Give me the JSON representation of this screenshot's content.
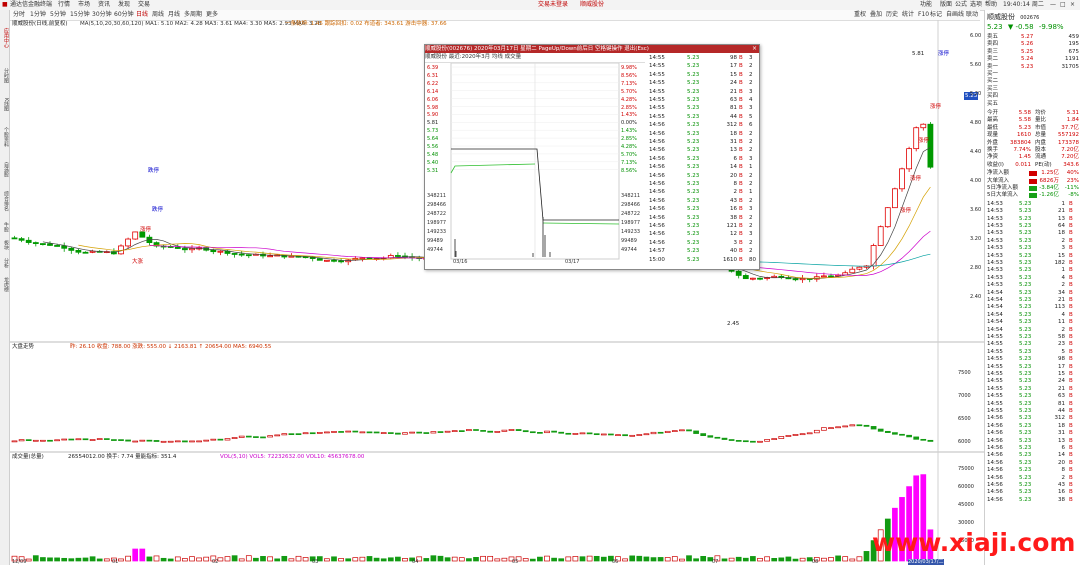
{
  "menubar": {
    "app_title": "通达信金融终端",
    "items": [
      "行情",
      "市场",
      "资讯",
      "发现",
      "交易"
    ],
    "center_label": "交易未登录",
    "center_stock": "顺威股份",
    "right_items": [
      "功能",
      "版面",
      "公式",
      "选项",
      "帮助"
    ],
    "clock": "19:40:14 周二"
  },
  "toolbar": {
    "periods": [
      "分时",
      "1分钟",
      "5分钟",
      "15分钟",
      "30分钟",
      "60分钟",
      "日线",
      "周线",
      "月线",
      "多周期",
      "更多"
    ],
    "active_period": "日线",
    "right_tools": [
      "重权",
      "叠加",
      "历史",
      "统计",
      "F10",
      "标记",
      "自画线",
      "联动"
    ]
  },
  "leftrail": {
    "tabs": [
      "应用中心",
      "分时图",
      "K线图",
      "个股资料",
      "自选股",
      "综合排名",
      "牛股",
      "板块",
      "分析",
      "龙虎榜"
    ]
  },
  "main_chart": {
    "title_line": "顺威股份(日线,前复权)",
    "ma_line": "MA(5,10,20,30,60,120)  MA1: 5.10  MA2: 4.28  MA3: 3.61  MA4: 3.30  MA5: 2.93  MA6: 3.28",
    "overlay_text": "一条乾坤: 1.45  跟踪回扣: 0.02  布道者: 343.61  游击中器: 37.66",
    "annotations": [
      "跌停",
      "涨停",
      "大涨",
      "跌停",
      "涨停",
      "涨停",
      "涨停",
      "涨停",
      "涨停"
    ],
    "low_label": "2.45",
    "peak_label": "5.81",
    "cur_price_tag": "5.23",
    "y_ticks": [
      "6.00",
      "5.60",
      "5.20",
      "4.80",
      "4.40",
      "4.00",
      "3.60",
      "3.20",
      "2.80",
      "2.40"
    ],
    "scroll_tabs": [
      "分笔",
      "分钟",
      "数值"
    ]
  },
  "middle_chart": {
    "title": "大盘走势",
    "info": "昨: 26.10   收盘: 788.00  涨跌: 555.00  ↓ 2163.81  ↑ 20654.00  MA5: 6940.55",
    "y_ticks": [
      "7500",
      "7000",
      "6500",
      "6000"
    ]
  },
  "volume_chart": {
    "title": "成交量(总量)",
    "info": "26554012.00  换手: 7.74  量能指标: 351.4",
    "vol_line": "VOL(5,10)  VOL5: 72232632.00  VOL10: 45637678.00",
    "y_ticks": [
      "75000",
      "60000",
      "45000",
      "30000",
      "15000"
    ],
    "x_dates": [
      "12/09",
      "01",
      "02",
      "03",
      "04",
      "05",
      "06",
      "07",
      "08",
      "09"
    ],
    "last_date": "2020/03/17/二"
  },
  "popup": {
    "title": "顺威股份(002676)  2020年03月17日 星期二  PageUp/Down前后日 空格键操作 退出(Esc)",
    "subline": "顺威股份   最近:2020年3月  均线  成交量",
    "price_axis": [
      "6.39",
      "6.31",
      "6.22",
      "6.14",
      "6.06",
      "5.98",
      "5.90",
      "5.81",
      "5.73",
      "5.64",
      "5.56",
      "5.48",
      "5.40",
      "5.31"
    ],
    "pct_axis": [
      "9.98%",
      "8.56%",
      "7.13%",
      "5.70%",
      "4.28%",
      "2.85%",
      "1.43%",
      "0.00%",
      "1.43%",
      "2.85%",
      "4.28%",
      "5.70%",
      "7.13%",
      "8.56%"
    ],
    "vol_axis_left": [
      "348211",
      "298466",
      "248722",
      "198977",
      "149233",
      "99489",
      "49744"
    ],
    "vol_axis_right": [
      "348211",
      "298466",
      "248722",
      "198977",
      "149233",
      "99489",
      "49744"
    ],
    "time_axis": [
      "03/16",
      "",
      "03/17"
    ],
    "ticks": [
      [
        "14:55",
        "5.23",
        "98",
        "B",
        "3"
      ],
      [
        "14:55",
        "5.23",
        "17",
        "B",
        "2"
      ],
      [
        "14:55",
        "5.23",
        "15",
        "B",
        "2"
      ],
      [
        "14:55",
        "5.23",
        "24",
        "B",
        "2"
      ],
      [
        "14:55",
        "5.23",
        "21",
        "B",
        "3"
      ],
      [
        "14:55",
        "5.23",
        "63",
        "B",
        "4"
      ],
      [
        "14:55",
        "5.23",
        "81",
        "B",
        "3"
      ],
      [
        "14:55",
        "5.23",
        "44",
        "B",
        "5"
      ],
      [
        "14:56",
        "5.23",
        "312",
        "B",
        "6"
      ],
      [
        "14:56",
        "5.23",
        "18",
        "B",
        "2"
      ],
      [
        "14:56",
        "5.23",
        "31",
        "B",
        "2"
      ],
      [
        "14:56",
        "5.23",
        "13",
        "B",
        "2"
      ],
      [
        "14:56",
        "5.23",
        "6",
        "B",
        "3"
      ],
      [
        "14:56",
        "5.23",
        "14",
        "B",
        "1"
      ],
      [
        "14:56",
        "5.23",
        "20",
        "B",
        "2"
      ],
      [
        "14:56",
        "5.23",
        "8",
        "B",
        "2"
      ],
      [
        "14:56",
        "5.23",
        "2",
        "B",
        "1"
      ],
      [
        "14:56",
        "5.23",
        "43",
        "B",
        "2"
      ],
      [
        "14:56",
        "5.23",
        "16",
        "B",
        "3"
      ],
      [
        "14:56",
        "5.23",
        "38",
        "B",
        "2"
      ],
      [
        "14:56",
        "5.23",
        "121",
        "B",
        "2"
      ],
      [
        "14:56",
        "5.23",
        "12",
        "B",
        "3"
      ],
      [
        "14:56",
        "5.23",
        "3",
        "B",
        "2"
      ],
      [
        "14:57",
        "5.23",
        "40",
        "B",
        "2"
      ],
      [
        "15:00",
        "5.23",
        "1610",
        "B",
        "80"
      ]
    ]
  },
  "quote_panel": {
    "name": "顺威股份",
    "code": "002676",
    "price": "5.23",
    "change": "-0.58",
    "pct": "-9.98%",
    "sell_rows": [
      [
        "卖五",
        "5.27",
        "459"
      ],
      [
        "卖四",
        "5.26",
        "195"
      ],
      [
        "卖三",
        "5.25",
        "675"
      ],
      [
        "卖二",
        "5.24",
        "1191"
      ],
      [
        "卖一",
        "5.23",
        "31705"
      ]
    ],
    "buy_rows": [
      [
        "买一",
        ""
      ],
      [
        "买二",
        ""
      ],
      [
        "买三",
        ""
      ],
      [
        "买四",
        ""
      ],
      [
        "买五",
        ""
      ]
    ],
    "stats": [
      [
        "今开",
        "5.58",
        "均价",
        "5.31"
      ],
      [
        "最高",
        "5.58",
        "量比",
        "1.84"
      ],
      [
        "最低",
        "5.23",
        "市值",
        "37.7亿"
      ],
      [
        "现量",
        "1610",
        "总量",
        "557192"
      ],
      [
        "外盘",
        "383804",
        "内盘",
        "173378"
      ],
      [
        "换手",
        "7.74%",
        "股本",
        "7.20亿"
      ],
      [
        "净资",
        "1.45",
        "流通",
        "7.20亿"
      ],
      [
        "收益(I)",
        "0.011",
        "PE(动)",
        "343.6"
      ]
    ],
    "flows": [
      [
        "净流入额",
        "1.25亿",
        "40%"
      ],
      [
        "大单流入",
        "6826万",
        "23%"
      ],
      [
        "5日净流入额",
        "-3.84亿",
        "-11%"
      ],
      [
        "5日大单流入",
        "-1.26亿",
        "-8%"
      ]
    ],
    "trades": [
      [
        "14:53",
        "5.23",
        "1",
        "B"
      ],
      [
        "14:53",
        "5.23",
        "21",
        "B"
      ],
      [
        "14:53",
        "5.23",
        "13",
        "B"
      ],
      [
        "14:53",
        "5.23",
        "64",
        "B"
      ],
      [
        "14:53",
        "5.23",
        "18",
        "B"
      ],
      [
        "14:53",
        "5.23",
        "2",
        "B"
      ],
      [
        "14:53",
        "5.23",
        "3",
        "B"
      ],
      [
        "14:53",
        "5.23",
        "15",
        "B"
      ],
      [
        "14:53",
        "5.23",
        "182",
        "B"
      ],
      [
        "14:53",
        "5.23",
        "1",
        "B"
      ],
      [
        "14:53",
        "5.23",
        "4",
        "B"
      ],
      [
        "14:53",
        "5.23",
        "2",
        "B"
      ],
      [
        "14:54",
        "5.23",
        "34",
        "B"
      ],
      [
        "14:54",
        "5.23",
        "21",
        "B"
      ],
      [
        "14:54",
        "5.23",
        "113",
        "B"
      ],
      [
        "14:54",
        "5.23",
        "4",
        "B"
      ],
      [
        "14:54",
        "5.23",
        "11",
        "B"
      ],
      [
        "14:54",
        "5.23",
        "2",
        "B"
      ],
      [
        "14:55",
        "5.23",
        "58",
        "B"
      ],
      [
        "14:55",
        "5.23",
        "23",
        "B"
      ],
      [
        "14:55",
        "5.23",
        "5",
        "B"
      ],
      [
        "14:55",
        "5.23",
        "98",
        "B"
      ],
      [
        "14:55",
        "5.23",
        "17",
        "B"
      ],
      [
        "14:55",
        "5.23",
        "15",
        "B"
      ],
      [
        "14:55",
        "5.23",
        "24",
        "B"
      ],
      [
        "14:55",
        "5.23",
        "21",
        "B"
      ],
      [
        "14:55",
        "5.23",
        "63",
        "B"
      ],
      [
        "14:55",
        "5.23",
        "81",
        "B"
      ],
      [
        "14:55",
        "5.23",
        "44",
        "B"
      ],
      [
        "14:56",
        "5.23",
        "312",
        "B"
      ],
      [
        "14:56",
        "5.23",
        "18",
        "B"
      ],
      [
        "14:56",
        "5.23",
        "31",
        "B"
      ],
      [
        "14:56",
        "5.23",
        "13",
        "B"
      ],
      [
        "14:56",
        "5.23",
        "6",
        "B"
      ],
      [
        "14:56",
        "5.23",
        "14",
        "B"
      ],
      [
        "14:56",
        "5.23",
        "20",
        "B"
      ],
      [
        "14:56",
        "5.23",
        "8",
        "B"
      ],
      [
        "14:56",
        "5.23",
        "2",
        "B"
      ],
      [
        "14:56",
        "5.23",
        "43",
        "B"
      ],
      [
        "14:56",
        "5.23",
        "16",
        "B"
      ],
      [
        "14:56",
        "5.23",
        "38",
        "B"
      ]
    ]
  },
  "watermark": "www.xiaji.com",
  "colors": {
    "up": "#e00000",
    "down": "#009900",
    "blue": "#0000dd",
    "magenta": "#ff00ff",
    "title_red": "#b52828"
  }
}
